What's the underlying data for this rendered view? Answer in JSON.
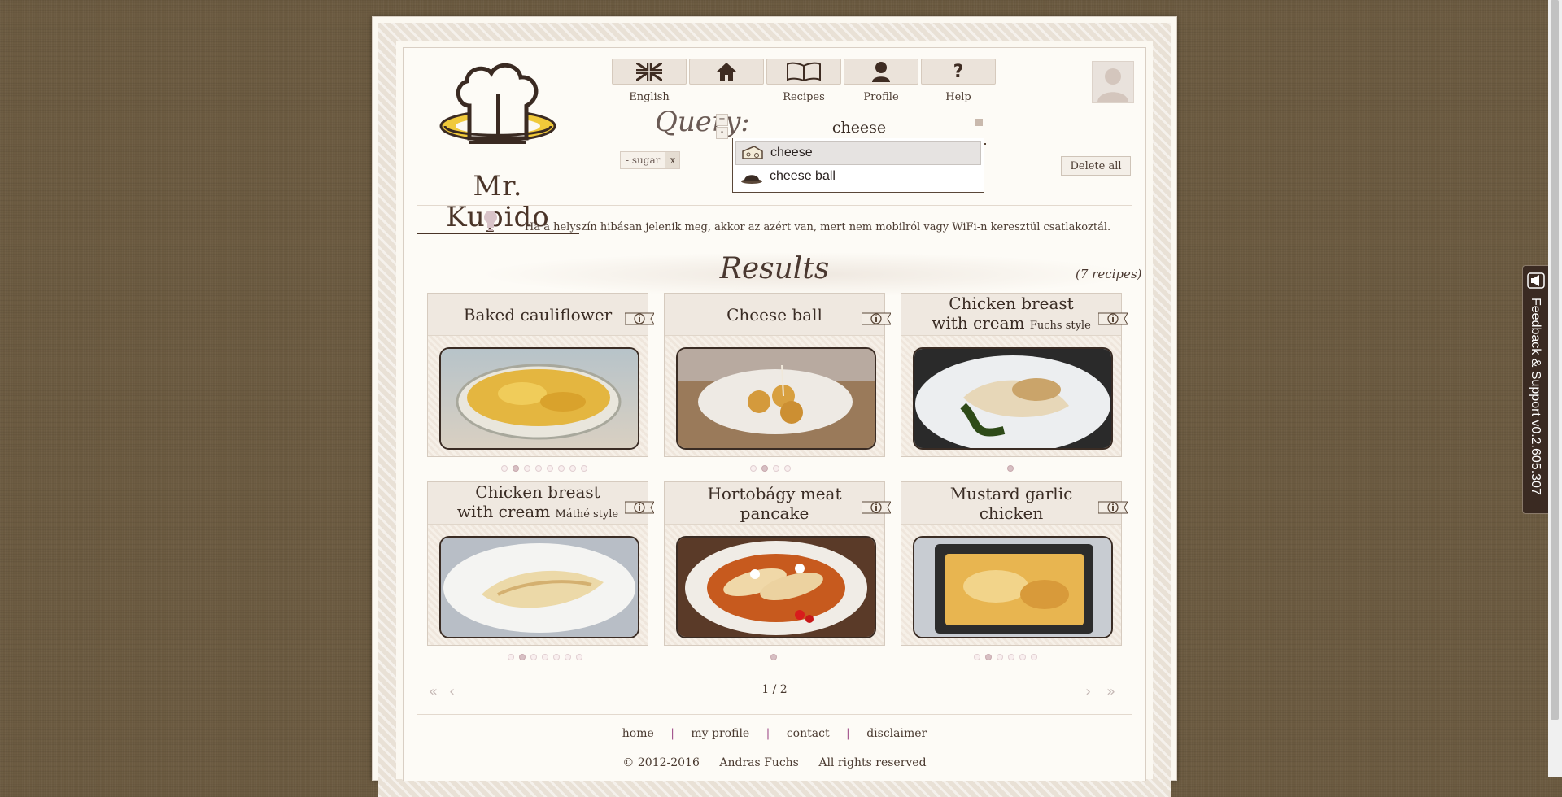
{
  "logo": {
    "text": "Mr. Kupido"
  },
  "nav": [
    {
      "label": "English",
      "icon": "uk-flag-icon"
    },
    {
      "label": "",
      "icon": "home-icon"
    },
    {
      "label": "Recipes",
      "icon": "book-icon"
    },
    {
      "label": "Profile",
      "icon": "profile-icon"
    },
    {
      "label": "Help",
      "icon": "help-icon"
    }
  ],
  "search": {
    "label": "Query:",
    "plus": "+",
    "minus": "-",
    "value": "cheese",
    "suggestions": [
      "cheese",
      "cheese ball"
    ],
    "excluded": {
      "text": "- sugar",
      "remove": "x"
    },
    "delete_all": "Delete all"
  },
  "tip": "Ha a helyszín hibásan jelenik meg, akkor az azért van, mert nem mobilról vagy WiFi-n keresztül csatlakoztál.",
  "results": {
    "title": "Results",
    "count": "(7 recipes)"
  },
  "recipes": [
    {
      "title": "Baked cauliflower",
      "suffix": "",
      "dots": 8,
      "active": 1
    },
    {
      "title": "Cheese ball",
      "suffix": "",
      "dots": 4,
      "active": 1
    },
    {
      "title": "Chicken breast with cream",
      "suffix": "Fuchs style",
      "dots": 1,
      "active": 0
    },
    {
      "title": "Chicken breast with cream",
      "suffix": "Máthé style",
      "dots": 7,
      "active": 1
    },
    {
      "title": "Hortobágy meat pancake",
      "suffix": "",
      "dots": 1,
      "active": 0
    },
    {
      "title": "Mustard garlic chicken",
      "suffix": "",
      "dots": 6,
      "active": 1
    }
  ],
  "pager": {
    "text": "1 / 2",
    "first": "«",
    "prev": "‹",
    "next": "›",
    "last": "»"
  },
  "footer": {
    "links": [
      "home",
      "my profile",
      "contact",
      "disclaimer"
    ],
    "separator": "|",
    "copyright": "© 2012-2016",
    "author": "Andras Fuchs",
    "rights": "All rights reserved"
  },
  "feedback": "Feedback & Support v0.2.605.307",
  "colors": {
    "background": "#6b5a40",
    "paper": "#fbf8f1",
    "accent": "#4a3428"
  }
}
